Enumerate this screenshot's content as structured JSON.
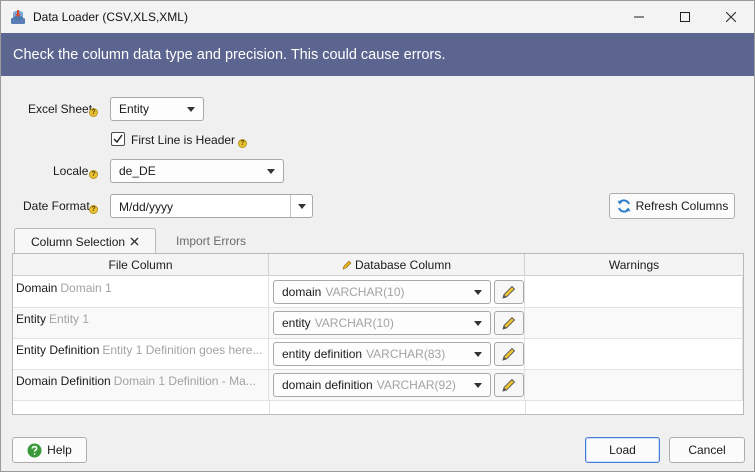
{
  "window": {
    "title": "Data Loader (CSV,XLS,XML)"
  },
  "banner": {
    "message": "Check the column data type and precision. This could cause errors."
  },
  "form": {
    "excel_sheet_label": "Excel Sheet",
    "excel_sheet_value": "Entity",
    "first_line_header_label": "First Line is Header",
    "first_line_header_checked": true,
    "locale_label": "Locale",
    "locale_value": "de_DE",
    "date_format_label": "Date Format",
    "date_format_value": "M/dd/yyyy",
    "refresh_label": "Refresh Columns"
  },
  "tabs": [
    {
      "label": "Column Selection",
      "active": true
    },
    {
      "label": "Import Errors",
      "active": false
    }
  ],
  "table": {
    "headers": [
      "File Column",
      "Database Column",
      "Warnings"
    ],
    "rows": [
      {
        "file_name": "Domain",
        "file_sample": "Domain 1",
        "db_column": "domain",
        "db_type": "VARCHAR(10)",
        "warning": ""
      },
      {
        "file_name": "Entity",
        "file_sample": "Entity 1",
        "db_column": "entity",
        "db_type": "VARCHAR(10)",
        "warning": ""
      },
      {
        "file_name": "Entity Definition",
        "file_sample": "Entity 1 Definition goes here...",
        "db_column": "entity definition",
        "db_type": "VARCHAR(83)",
        "warning": ""
      },
      {
        "file_name": "Domain Definition",
        "file_sample": "Domain 1 Definition - Ma...",
        "db_column": "domain definition",
        "db_type": "VARCHAR(92)",
        "warning": ""
      }
    ]
  },
  "footer": {
    "help_label": "Help",
    "load_label": "Load",
    "cancel_label": "Cancel"
  },
  "colors": {
    "banner": "#5c6590",
    "help_green": "#3a9a3a",
    "hint_yellow": "#e9c234"
  },
  "icons": {
    "app": "data-loader-icon",
    "minimize": "minimize-icon",
    "maximize": "maximize-icon",
    "close": "close-icon",
    "refresh": "refresh-icon",
    "pencil": "pencil-icon",
    "help": "question-icon"
  }
}
